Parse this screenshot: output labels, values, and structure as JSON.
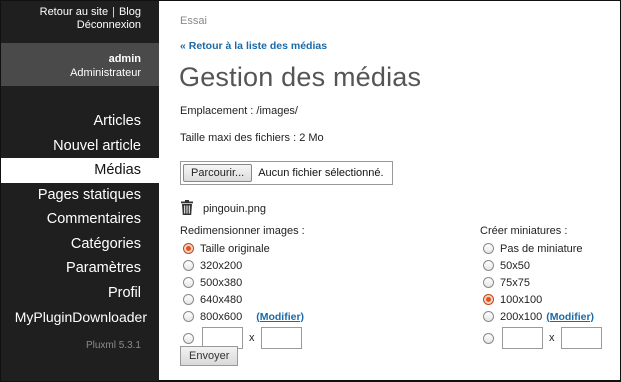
{
  "sidebar": {
    "top_links": {
      "site": "Retour au site",
      "separator": "|",
      "blog": "Blog",
      "logout": "Déconnexion"
    },
    "user": {
      "name": "admin",
      "role": "Administrateur"
    },
    "menu": [
      {
        "label": "Articles",
        "active": false
      },
      {
        "label": "Nouvel article",
        "active": false
      },
      {
        "label": "Médias",
        "active": true
      },
      {
        "label": "Pages statiques",
        "active": false
      },
      {
        "label": "Commentaires",
        "active": false
      },
      {
        "label": "Catégories",
        "active": false
      },
      {
        "label": "Paramètres",
        "active": false
      },
      {
        "label": "Profil",
        "active": false
      },
      {
        "label": "MyPluginDownloader",
        "active": false
      }
    ],
    "version": "Pluxml 5.3.1"
  },
  "main": {
    "breadcrumb": "Essai",
    "back_link": "« Retour à la liste des médias",
    "title": "Gestion des médias",
    "location": "Emplacement : /images/",
    "max_size": "Taille maxi des fichiers : 2 Mo",
    "file_input": {
      "button_label": "Parcourir...",
      "status": "Aucun fichier sélectionné."
    },
    "uploaded_file": {
      "icon": "trash-icon",
      "name": "pingouin.png"
    },
    "resize": {
      "title": "Redimensionner images :",
      "options": [
        {
          "label": "Taille originale",
          "checked": true
        },
        {
          "label": "320x200",
          "checked": false
        },
        {
          "label": "500x380",
          "checked": false
        },
        {
          "label": "640x480",
          "checked": false
        },
        {
          "label": "800x600",
          "checked": false,
          "modify": "(Modifier)"
        }
      ],
      "custom_x": "x"
    },
    "thumbs": {
      "title": "Créer miniatures :",
      "options": [
        {
          "label": "Pas de miniature",
          "checked": false
        },
        {
          "label": "50x50",
          "checked": false
        },
        {
          "label": "75x75",
          "checked": false
        },
        {
          "label": "100x100",
          "checked": true
        },
        {
          "label": "200x100",
          "checked": false,
          "modify": "(Modifier)"
        }
      ],
      "custom_x": "x"
    },
    "submit_label": "Envoyer"
  },
  "colors": {
    "sidebar_bg": "#1f1f1f",
    "user_box_bg": "#4a4a4a",
    "link": "#1a6aa8",
    "radio_checked": "#e25519"
  }
}
